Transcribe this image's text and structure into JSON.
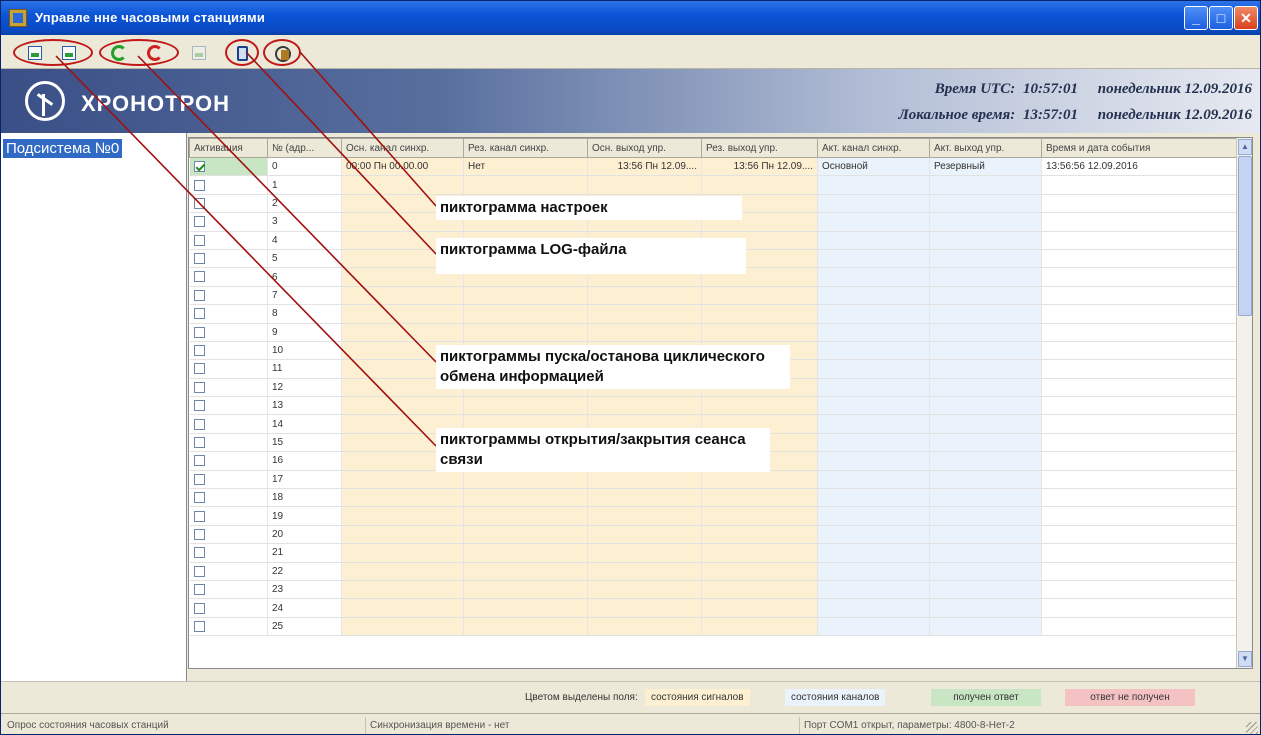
{
  "window": {
    "title": "Управле нне часовыми станциями",
    "minimize": "_",
    "maximize": "□",
    "close": "✕"
  },
  "toolbar": {
    "buttons": [
      {
        "name": "open-session",
        "icon": "open-session-icon"
      },
      {
        "name": "close-session",
        "icon": "close-session-icon"
      },
      {
        "name": "start-cycle",
        "icon": "start-cycle-icon"
      },
      {
        "name": "stop-cycle",
        "icon": "stop-cycle-icon"
      },
      {
        "name": "disabled",
        "icon": "disabled-icon"
      },
      {
        "name": "log-file",
        "icon": "log-file-icon"
      },
      {
        "name": "settings",
        "icon": "settings-icon"
      }
    ]
  },
  "header": {
    "logo": "ХРОНОТРОН",
    "utc_label": "Время UTC:",
    "utc_time": "10:57:01",
    "utc_date": "понедельник 12.09.2016",
    "local_label": "Локальное время:",
    "local_time": "13:57:01",
    "local_date": "понедельник 12.09.2016"
  },
  "tree": {
    "item": "Подсистема №0"
  },
  "grid": {
    "columns": [
      "Активация",
      "№ (адр...",
      "Осн. канал синхр.",
      "Рез. канал синхр.",
      "Осн. выход упр.",
      "Рез. выход упр.",
      "Акт. канал синхр.",
      "Акт. выход упр.",
      "Время и дата события"
    ],
    "first_row": {
      "id": "0",
      "main_sync": "00:00 Пн 00.00.00",
      "res_sync": "Нет",
      "main_out": "13:56 Пн 12.09....",
      "res_out": "13:56 Пн 12.09....",
      "act_sync": "Основной",
      "act_out": "Резервный",
      "event_time": "13:56:56 12.09.2016"
    },
    "row_ids": [
      "1",
      "2",
      "3",
      "4",
      "5",
      "6",
      "7",
      "8",
      "9",
      "10",
      "11",
      "12",
      "13",
      "14",
      "15",
      "16",
      "17",
      "18",
      "19",
      "20",
      "21",
      "22",
      "23",
      "24",
      "25"
    ]
  },
  "legend": {
    "caption": "Цветом выделены поля:",
    "signals": "состояния сигналов",
    "channels": "состояния каналов",
    "answered": "получен ответ",
    "not_answered": "ответ не получен"
  },
  "status": {
    "poll": "Опрос состояния часовых станций",
    "sync": "Синхронизация времени - нет",
    "port": "Порт COM1 открыт, параметры: 4800-8-Нет-2"
  },
  "annotations": {
    "settings": "пиктограмма настроек",
    "log": "пиктограмма LOG-файла",
    "cycle": "пиктограммы пуска/останова циклического обмена информацией",
    "session": "пиктограммы открытия/закрытия сеанса связи"
  },
  "colors": {
    "signals": "#fdf0d2",
    "channels": "#eaf2fb",
    "answered": "#c9e6c4",
    "not_answered": "#f5c2c4",
    "callout_line": "#a01010",
    "callout_oval": "#c01818"
  }
}
